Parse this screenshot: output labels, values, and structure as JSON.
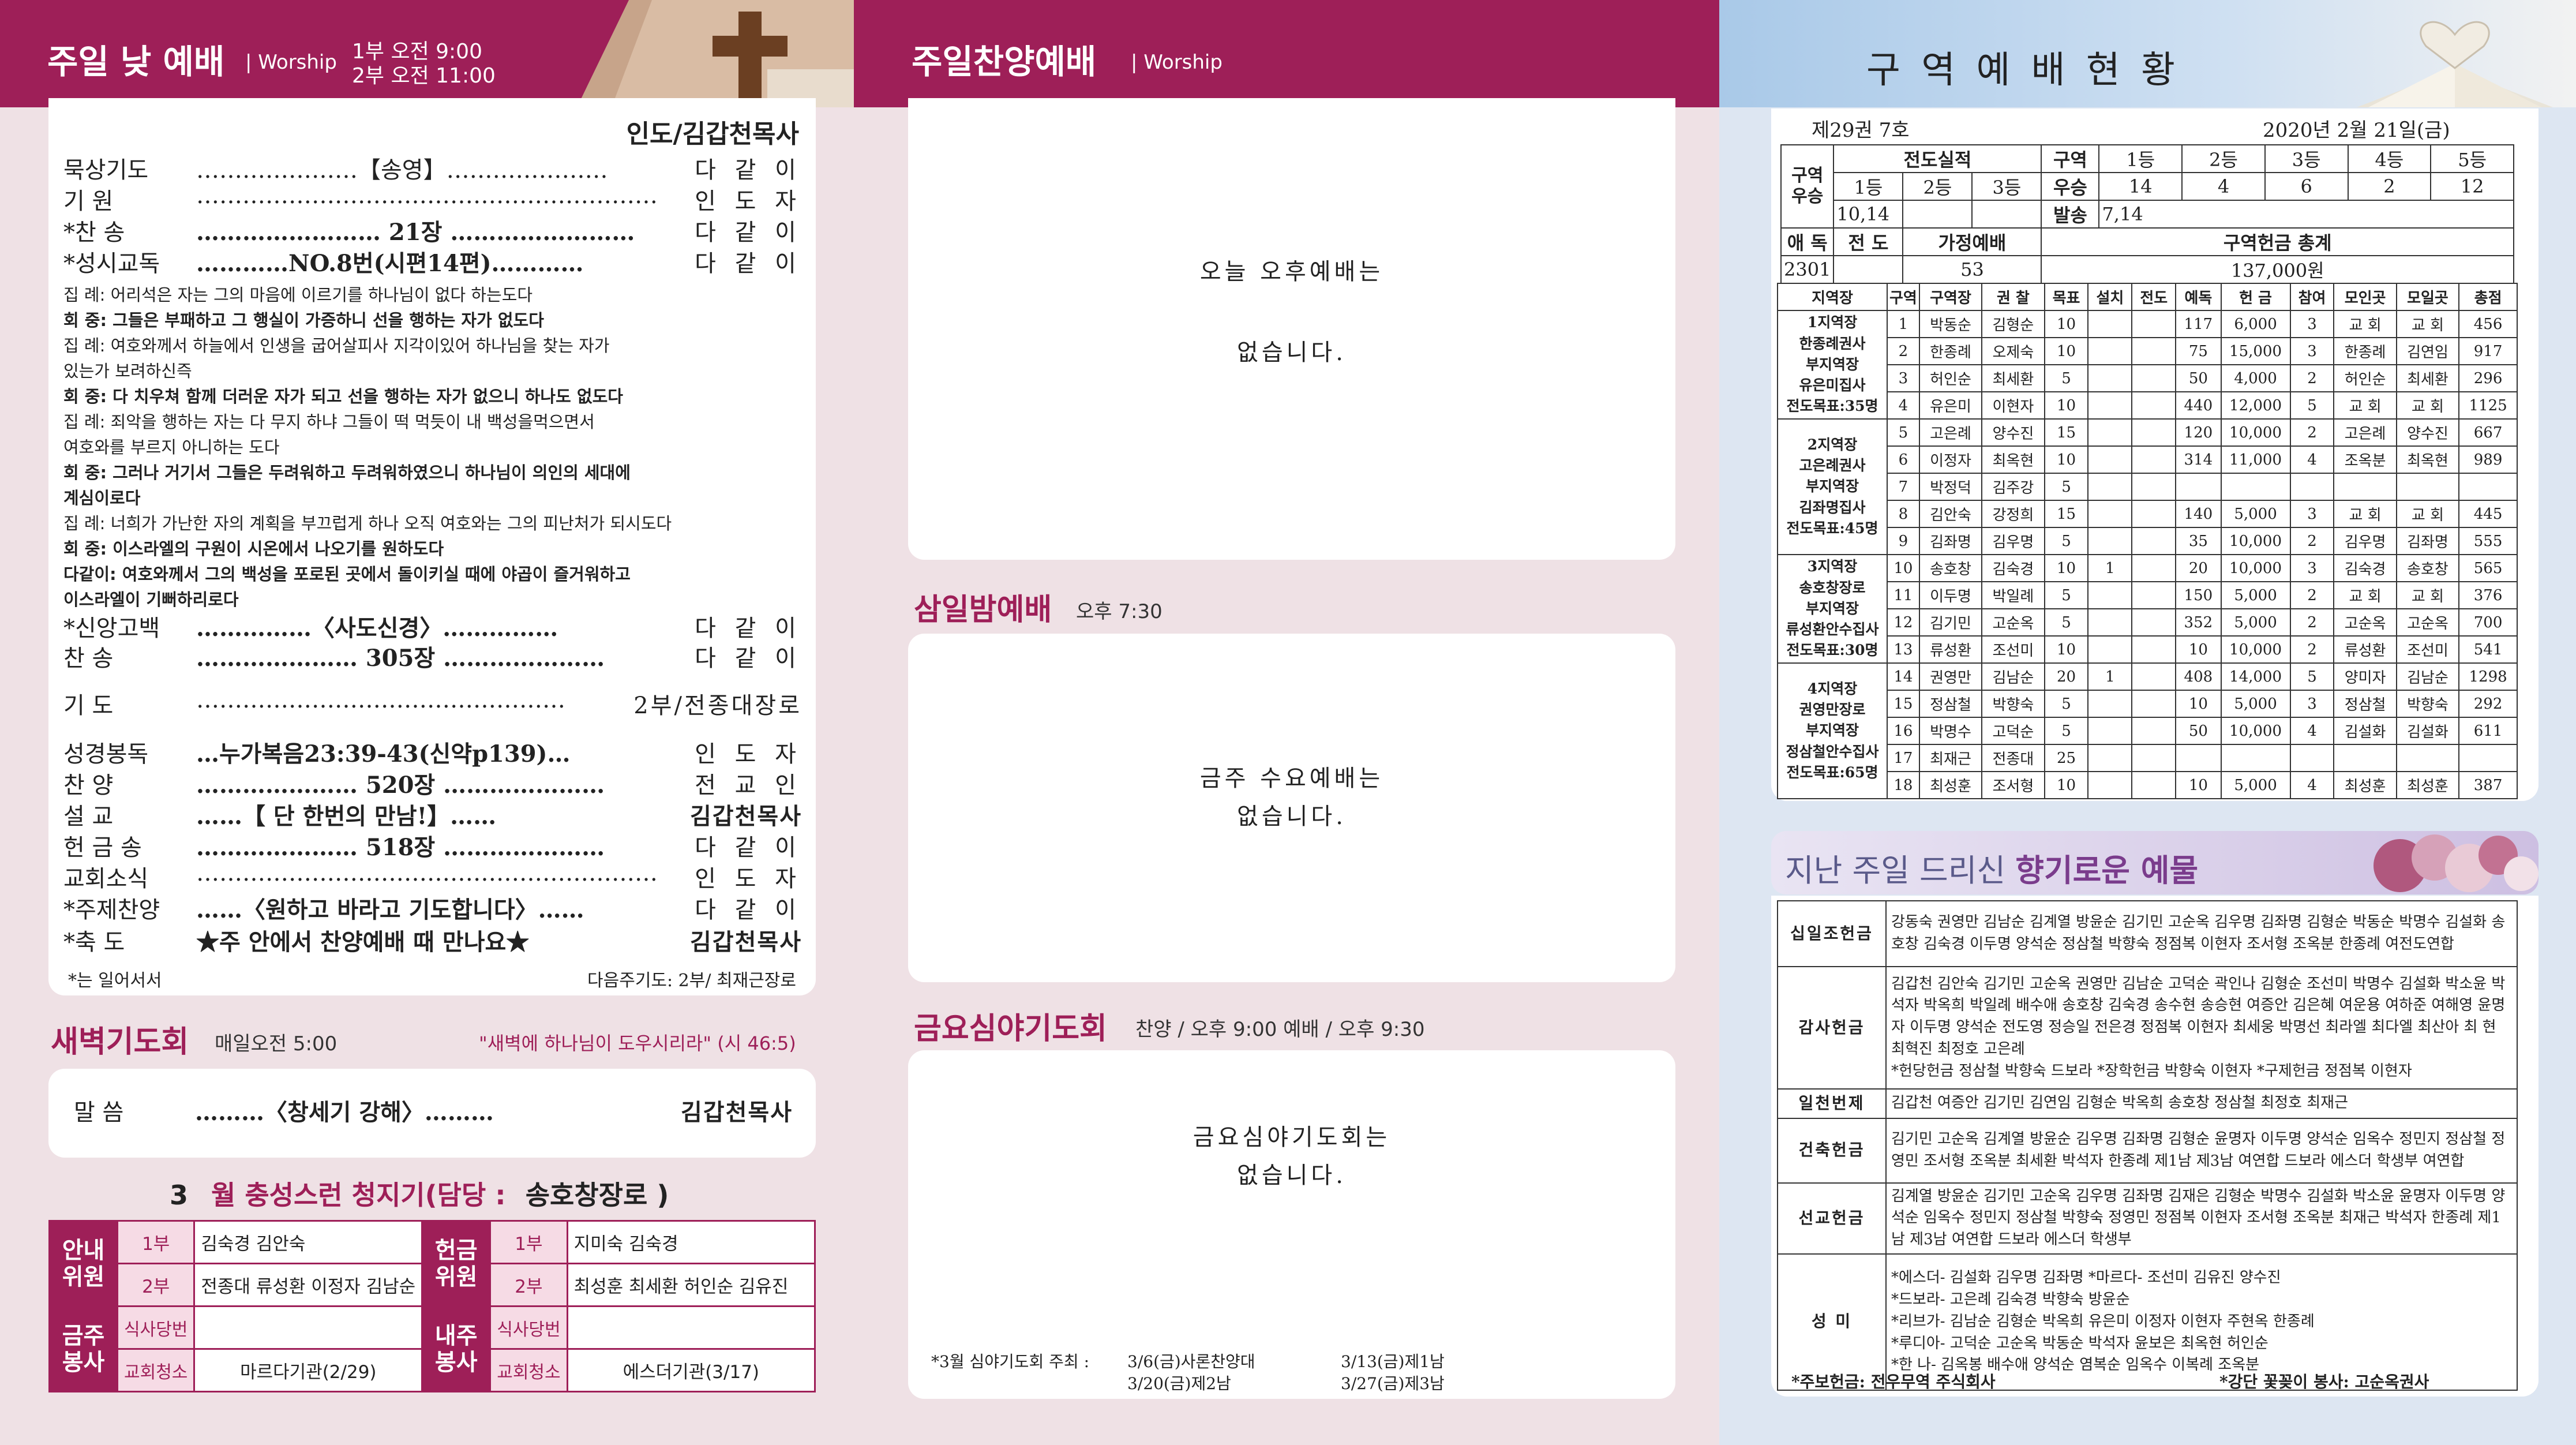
{
  "p1": {
    "title": "주일 낮 예배",
    "worship_en": "Worship",
    "time1": "1부 오전  9:00",
    "time2": "2부 오전 11:00",
    "leader": "인도/김갑천목사",
    "order": [
      {
        "a": "묵상기도",
        "b": "…………………【송영】…………………",
        "c": "다 같 이",
        "bold": false
      },
      {
        "a": "기    원",
        "b": "……………………………………………………",
        "c": "인 도 자",
        "bold": false
      },
      {
        "a": "*찬    송",
        "b": "…………………… 21장 ……………………",
        "c": "다 같 이",
        "bold": false
      },
      {
        "a": "*성시교독",
        "b": "…………NO.8번(시편14편)…………",
        "c": "다 같 이",
        "bold": false
      }
    ],
    "litany": [
      "집 례: 어리석은 자는 그의 마음에 이르기를 하나님이 없다 하는도다",
      "회 중: 그들은 부패하고 그 행실이 가증하니 선을 행하는 자가 없도다",
      "집 례: 여호와께서 하늘에서 인생을 굽어살피사 지각이있어 하나님을 찾는 자가",
      "          있는가 보려하신즉",
      "회 중: 다 치우쳐 함께 더러운 자가 되고 선을 행하는 자가 없으니 하나도 없도다",
      "집 례: 죄악을 행하는 자는 다 무지 하냐 그들이 떡 먹듯이 내 백성을먹으면서",
      "          여호와를 부르지 아니하는 도다",
      "회 중: 그러나 거기서 그들은 두려워하고 두려워하였으니 하나님이 의인의 세대에",
      "          계심이로다",
      "집 례: 너희가 가난한 자의 계획을 부끄럽게 하나 오직 여호와는 그의 피난처가 되시도다",
      "회 중: 이스라엘의 구원이 시온에서 나오기를 원하도다",
      "다같이: 여호와께서 그의 백성을 포로된 곳에서 돌이키실 때에 야곱이 즐거워하고",
      "          이스라엘이 기뻐하리로다"
    ],
    "order2": [
      {
        "a": "*신앙고백",
        "b": "……………〈사도신경〉……………",
        "c": "다 같 이"
      },
      {
        "a": "찬    송",
        "b": "………………… 305장 …………………",
        "c": "다 같 이"
      },
      {
        "a": "기    도",
        "b": "…………………………………………",
        "c": "2부/전종대장로"
      },
      {
        "a": "성경봉독",
        "b": "…누가복음23:39-43(신약p139)…",
        "c": "인 도 자"
      },
      {
        "a": "찬    양",
        "b": "………………… 520장 …………………",
        "c": "전 교 인"
      },
      {
        "a": "설    교",
        "b": "……【 단 한번의 만남!】……",
        "c": "김갑천목사"
      },
      {
        "a": "헌 금 송",
        "b": "………………… 518장 …………………",
        "c": "다 같 이"
      },
      {
        "a": "교회소식",
        "b": "……………………………………………………",
        "c": "인 도 자"
      },
      {
        "a": "*주제찬양",
        "b": "……〈원하고 바라고 기도합니다〉……",
        "c": "다 같 이"
      },
      {
        "a": "*축    도",
        "b": "★주 안에서 찬양예배 때 만나요★",
        "c": "김갑천목사"
      }
    ],
    "footnote": "*는 일어서서",
    "next_prayer": "다음주기도:  2부/ 최재근장로",
    "dawn_title": "새벽기도회",
    "dawn_time": "매일오전 5:00",
    "dawn_verse": "\"새벽에 하나님이 도우시리라\" (시 46:5)",
    "dawn_a": "말    씀",
    "dawn_b": "………〈창세기 강해〉………",
    "dawn_c": "김갑천목사",
    "month_num": "3",
    "month_title": "월 충성스런 청지기(담당 :",
    "month_who": "송호창장로 )",
    "duty": {
      "anne": "안내\n위원",
      "offer": "헌금\n위원",
      "geumju": "금주\n봉사",
      "naeju": "내주\n봉사",
      "bu1": "1부",
      "bu2": "2부",
      "anne1": "김숙경 김안숙",
      "anne2": "전종대 류성환 이정자 김남순",
      "offer1": "지미숙 김숙경",
      "offer2": "최성훈 최세환 허인순 김유진",
      "meal": "식사당번",
      "clean": "교회청소",
      "clean_now": "마르다기관(2/29)",
      "clean_next": "에스더기관(3/17)"
    }
  },
  "p2": {
    "title": "주일찬양예배",
    "worship_en": "Worship",
    "msg1a": "오늘 오후예배는",
    "msg1b": "없습니다.",
    "wed_title": "삼일밤예배",
    "wed_time": "오후 7:30",
    "msg2a": "금주 수요예배는",
    "msg2b": "없습니다.",
    "fri_title": "금요심야기도회",
    "fri_time": "찬양 / 오후 9:00   예배 / 오후 9:30",
    "msg3a": "금요심야기도회는",
    "msg3b": "없습니다.",
    "sched_label": "*3월 심야기도회 주최 :",
    "sched1": "3/6(금)사론찬양대",
    "sched2": "3/13(금)제1남",
    "sched3": "3/20(금)제2남",
    "sched4": "3/27(금)제3남"
  },
  "p3": {
    "title": "구 역 예 배 현 황",
    "issue": "제29권 7호",
    "date": "2020년 2월 21일(금)",
    "summary": {
      "gy": "구역\n우승",
      "jeondo": "전도실적",
      "r1": "1등",
      "r2": "2등",
      "r3": "3등",
      "r1v": "10,14",
      "r2v": "",
      "r3v": "",
      "guyeok": "구역",
      "useung": "우승",
      "balsong": "발송",
      "g1": "1등",
      "g2": "2등",
      "g3": "3등",
      "g4": "4등",
      "g5": "5등",
      "gv1": "14",
      "gv2": "4",
      "gv3": "6",
      "gv4": "2",
      "gv5": "12",
      "balsong_v": "7,14",
      "aedok": "애 독",
      "jd": "전 도",
      "gajeong": "가정예배",
      "total_label": "구역헌금 총계",
      "aedok_v": "2301",
      "jd_v": "",
      "gajeong_v": "53",
      "total_v": "137,000원"
    },
    "head": [
      "지역장",
      "구역",
      "구역장",
      "권 찰",
      "목표",
      "설치",
      "전도",
      "예독",
      "헌 금",
      "참여",
      "모인곳",
      "모일곳",
      "총점"
    ],
    "groups": [
      "1지역장\n한종례권사\n부지역장\n유은미집사\n전도목표:35명",
      "2지역장\n고은례권사\n부지역장\n김좌명집사\n전도목표:45명",
      "3지역장\n송호창장로\n부지역장\n류성환안수집사\n전도목표:30명",
      "4지역장\n권영만장로\n부지역장\n정삼철안수집사\n전도목표:65명"
    ],
    "rows": [
      [
        "1",
        "박동순",
        "김형순",
        "10",
        "",
        "",
        "117",
        "6,000",
        "3",
        "교 회",
        "교 회",
        "456"
      ],
      [
        "2",
        "한종례",
        "오제숙",
        "10",
        "",
        "",
        "75",
        "15,000",
        "3",
        "한종례",
        "김연임",
        "917"
      ],
      [
        "3",
        "허인순",
        "최세환",
        "5",
        "",
        "",
        "50",
        "4,000",
        "2",
        "허인순",
        "최세환",
        "296"
      ],
      [
        "4",
        "유은미",
        "이현자",
        "10",
        "",
        "",
        "440",
        "12,000",
        "5",
        "교 회",
        "교 회",
        "1125"
      ],
      [
        "5",
        "고은례",
        "양수진",
        "15",
        "",
        "",
        "120",
        "10,000",
        "2",
        "고은례",
        "양수진",
        "667"
      ],
      [
        "6",
        "이정자",
        "최옥현",
        "10",
        "",
        "",
        "314",
        "11,000",
        "4",
        "조옥분",
        "최옥현",
        "989"
      ],
      [
        "7",
        "박정덕",
        "김주강",
        "5",
        "",
        "",
        "",
        "",
        "",
        "",
        "",
        ""
      ],
      [
        "8",
        "김안숙",
        "강정희",
        "15",
        "",
        "",
        "140",
        "5,000",
        "3",
        "교 회",
        "교 회",
        "445"
      ],
      [
        "9",
        "김좌명",
        "김우명",
        "5",
        "",
        "",
        "35",
        "10,000",
        "2",
        "김우명",
        "김좌명",
        "555"
      ],
      [
        "10",
        "송호창",
        "김숙경",
        "10",
        "1",
        "",
        "20",
        "10,000",
        "3",
        "김숙경",
        "송호창",
        "565"
      ],
      [
        "11",
        "이두명",
        "박일례",
        "5",
        "",
        "",
        "150",
        "5,000",
        "2",
        "교 회",
        "교 회",
        "376"
      ],
      [
        "12",
        "김기민",
        "고순옥",
        "5",
        "",
        "",
        "352",
        "5,000",
        "2",
        "고순옥",
        "고순옥",
        "700"
      ],
      [
        "13",
        "류성환",
        "조선미",
        "10",
        "",
        "",
        "10",
        "10,000",
        "2",
        "류성환",
        "조선미",
        "541"
      ],
      [
        "14",
        "권영만",
        "김남순",
        "20",
        "1",
        "",
        "408",
        "14,000",
        "5",
        "양미자",
        "김남순",
        "1298"
      ],
      [
        "15",
        "정삼철",
        "박향숙",
        "5",
        "",
        "",
        "10",
        "5,000",
        "3",
        "정삼철",
        "박향숙",
        "292"
      ],
      [
        "16",
        "박명수",
        "고덕순",
        "5",
        "",
        "",
        "50",
        "10,000",
        "4",
        "김설화",
        "김설화",
        "611"
      ],
      [
        "17",
        "최재근",
        "전종대",
        "25",
        "",
        "",
        "",
        "",
        "",
        "",
        "",
        ""
      ],
      [
        "18",
        "최성훈",
        "조서형",
        "10",
        "",
        "",
        "10",
        "5,000",
        "4",
        "최성훈",
        "최성훈",
        "387"
      ]
    ],
    "offer_title_a": "지난 주일 드리신 ",
    "offer_title_b": "향기로운 예물",
    "offerings": [
      {
        "label": "십일조헌금",
        "text": "강동숙 권영만 김남순 김계열 방윤순 김기민 고순옥 김우명 김좌명 김형순 박동순 박명수 김설화 송호창 김숙경 이두명 양석순 정삼철 박향숙 정점복 이현자 조서형 조옥분 한종례 여전도연합"
      },
      {
        "label": "감사헌금",
        "text": "김갑천 김안숙 김기민 고순옥 권영만 김남순 고덕순 곽인나 김형순 조선미 박명수 김설화 박소윤 박석자 박옥희 박일례 배수애 송호창 김숙경 송수현 송승현 여증안 김은혜 여운용 여하준 여해영 윤명자 이두명 양석순 전도영 정승일 전은경 정점복 이현자 최세웅 박명선 최라엘 최다엘 최산아 최  현 최혁진 최정호 고은례\n*헌당헌금 정삼철 박향숙 드보라 *장학헌금 박향숙 이현자  *구제헌금 정점복 이현자"
      },
      {
        "label": "일천번제",
        "text": "김갑천 여증안 김기민 김연임 김형순 박옥희 송호창  정삼철 최정호 최재근"
      },
      {
        "label": "건축헌금",
        "text": "김기민 고순옥 김계열 방윤순 김우명 김좌명 김형순 윤명자 이두명 양석순 임옥수 정민지 정삼철 정영민 조서형 조옥분 최세환 박석자 한종례 제1남  제3남   여연합 드보라 에스더 학생부 여연합"
      },
      {
        "label": "선교헌금",
        "text": "김계열 방윤순 김기민 고순옥 김우명 김좌명 김재은 김형순 박명수 김설화 박소윤 윤명자 이두명 양석순 임옥수 정민지 정삼철 박향숙 정영민 정점복 이현자 조서형 조옥분 최재근 박석자 한종례 제1남  제3남  여연합 드보라 에스더 학생부"
      },
      {
        "label": "성    미",
        "text": "*에스더-      김설화 김우명 김좌명            *마르다- 조선미 김유진 양수진\n*드보라-      고은례 김숙경 박향숙 방윤순\n*리브가-      김남순 김형순 박옥희 유은미 이정자 이현자 주현옥 한종례\n*루디아-      고덕순 고순옥 박동순 박석자 윤보은 최옥현 허인순\n*한  나-      김옥봉 배수애 양석순 염복순 임옥수 이복례 조옥분"
      }
    ],
    "foot_left": "*주보헌금: 전우무역 주식회사",
    "foot_right": "*강단 꽃꽂이 봉사: 고순옥권사"
  }
}
